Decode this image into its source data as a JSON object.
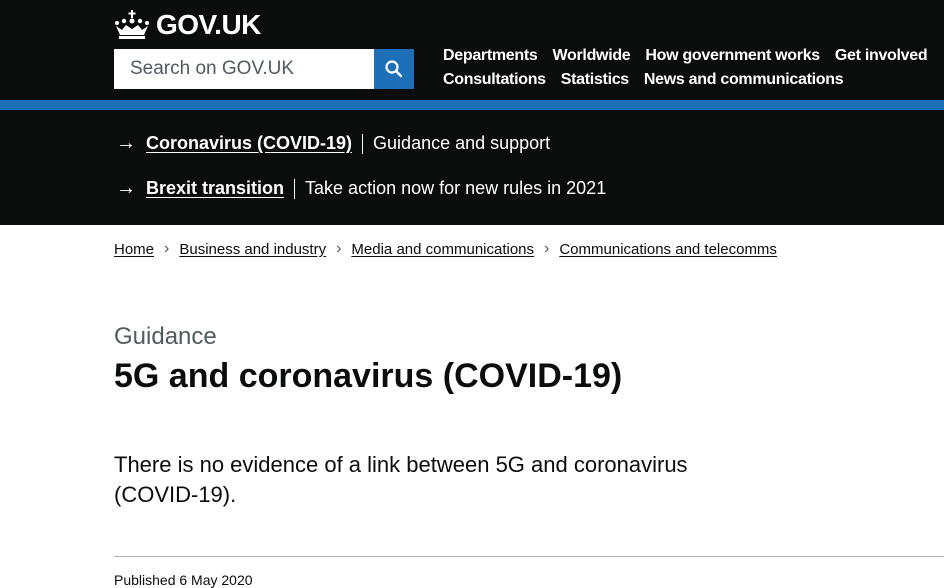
{
  "header": {
    "logo_text": "GOV.UK",
    "search": {
      "placeholder": "Search on GOV.UK",
      "value": "",
      "button_icon": "search-icon"
    },
    "nav": {
      "row1": [
        "Departments",
        "Worldwide",
        "How government works",
        "Get involved"
      ],
      "row2": [
        "Consultations",
        "Statistics",
        "News and communications"
      ]
    }
  },
  "banner": {
    "items": [
      {
        "link": "Coronavirus (COVID-19)",
        "description": "Guidance and support"
      },
      {
        "link": "Brexit transition",
        "description": "Take action now for new rules in 2021"
      }
    ]
  },
  "breadcrumbs": [
    "Home",
    "Business and industry",
    "Media and communications",
    "Communications and telecomms"
  ],
  "page": {
    "caption": "Guidance",
    "title": "5G and coronavirus (COVID-19)",
    "lead": "There is no evidence of a link between 5G and coronavirus (COVID-19).",
    "published": "Published 6 May 2020"
  },
  "colors": {
    "header_bg": "#0b0c0c",
    "brand_blue": "#1d70b8",
    "text": "#0b0c0c",
    "secondary_text": "#505a5f"
  }
}
